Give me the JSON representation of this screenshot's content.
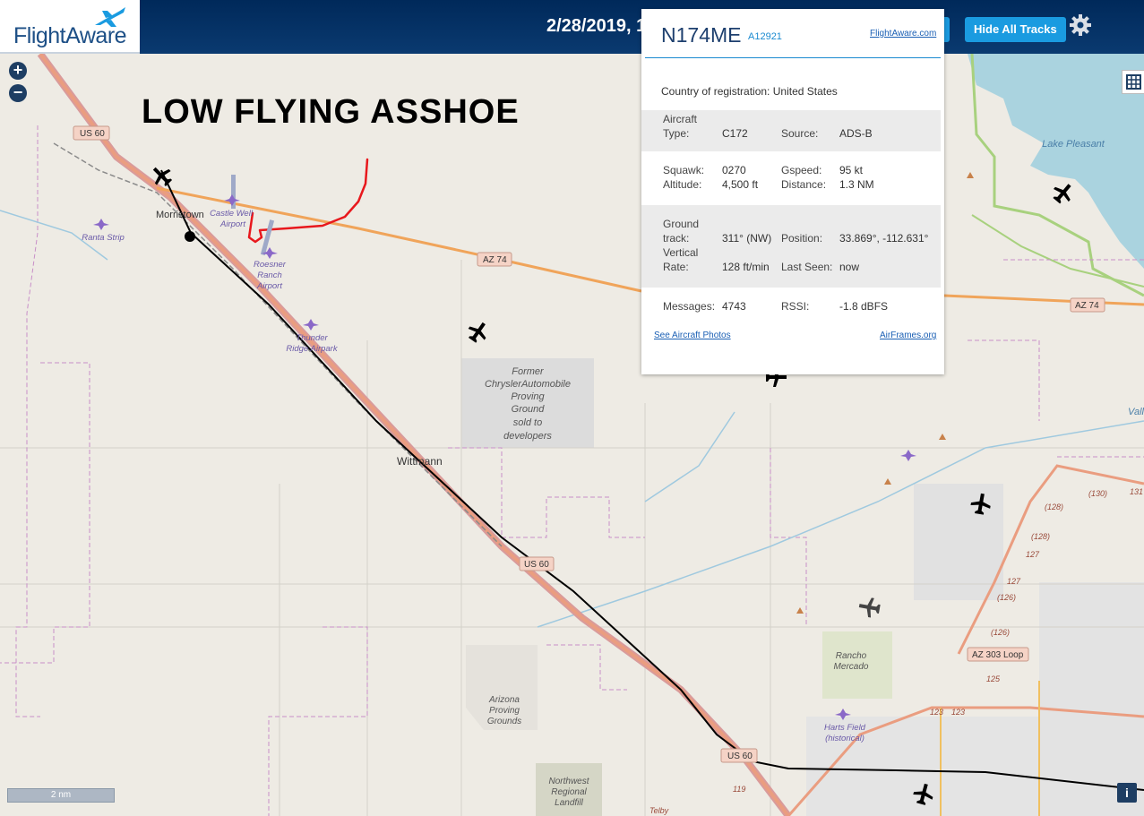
{
  "header": {
    "logo_text": "FlightAware",
    "datetime": "2/28/2019, 1",
    "hide_tracks_label": "Hide All Tracks"
  },
  "annotation": "LOW FLYING ASSHOE",
  "map_labels": {
    "us60_a": "US 60",
    "us60_b": "US 60",
    "us60_c": "US 60",
    "az74_a": "AZ 74",
    "az74_b": "AZ 74",
    "az303": "AZ 303 Loop",
    "morristown": "Morristown",
    "wittmann": "Wittmann",
    "castle_well_1": "Castle Well",
    "castle_well_2": "Airport",
    "ranta": "Ranta Strip",
    "roesner_1": "Roesner",
    "roesner_2": "Ranch",
    "roesner_3": "Airport",
    "thunder_1": "Thunder",
    "thunder_2": "Ridge Airpark",
    "chrysler_1": "Former",
    "chrysler_2": "ChryslerAutomobile",
    "chrysler_3": "Proving",
    "chrysler_4": "Ground",
    "chrysler_5": "sold to",
    "chrysler_6": "developers",
    "azpg_1": "Arizona",
    "azpg_2": "Proving",
    "azpg_3": "Grounds",
    "nwrl_1": "Northwest",
    "nwrl_2": "Regional",
    "nwrl_3": "Landfill",
    "rancho_1": "Rancho",
    "rancho_2": "Mercado",
    "harts_1": "Harts Field",
    "harts_2": "(historical)",
    "lake": "Lake Pleasant",
    "vall": "Vall",
    "r130": "(130)",
    "r131": "131",
    "r128a": "(128)",
    "r128b": "(128)",
    "r127a": "127",
    "r127b": "127",
    "r126a": "(126)",
    "r126b": "(126)",
    "r125": "125",
    "r123a": "123",
    "r123b": "123",
    "r119": "119",
    "telby": "Telby"
  },
  "scale_label": "2 nm",
  "info_label": "i",
  "popup": {
    "registration": "N174ME",
    "hex": "A12921",
    "source_link": "FlightAware.com",
    "country_label": "Country of registration:",
    "country_value": "United States",
    "aircraft_type_label_1": "Aircraft",
    "aircraft_type_label_2": "Type:",
    "aircraft_type": "C172",
    "source_label": "Source:",
    "source": "ADS-B",
    "squawk_label": "Squawk:",
    "squawk": "0270",
    "altitude_label": "Altitude:",
    "altitude": "4,500 ft",
    "gspeed_label": "Gspeed:",
    "gspeed": "95 kt",
    "distance_label": "Distance:",
    "distance": "1.3 NM",
    "ground_label_1": "Ground",
    "ground_label_2": "track:",
    "ground_track": "311° (NW)",
    "position_label": "Position:",
    "position": "33.869°, -112.631°",
    "vertical_label_1": "Vertical",
    "vertical_label_2": "Rate:",
    "vertical_rate": "128 ft/min",
    "last_seen_label": "Last Seen:",
    "last_seen": "now",
    "messages_label": "Messages:",
    "messages": "4743",
    "rssi_label": "RSSI:",
    "rssi": "-1.8 dBFS",
    "photos_link": "See Aircraft Photos",
    "airframes_link": "AirFrames.org"
  },
  "colors": {
    "header_bg": "#00295a",
    "button": "#1a9be0",
    "track_red": "#e8181d",
    "highway": "#f0a45a"
  }
}
